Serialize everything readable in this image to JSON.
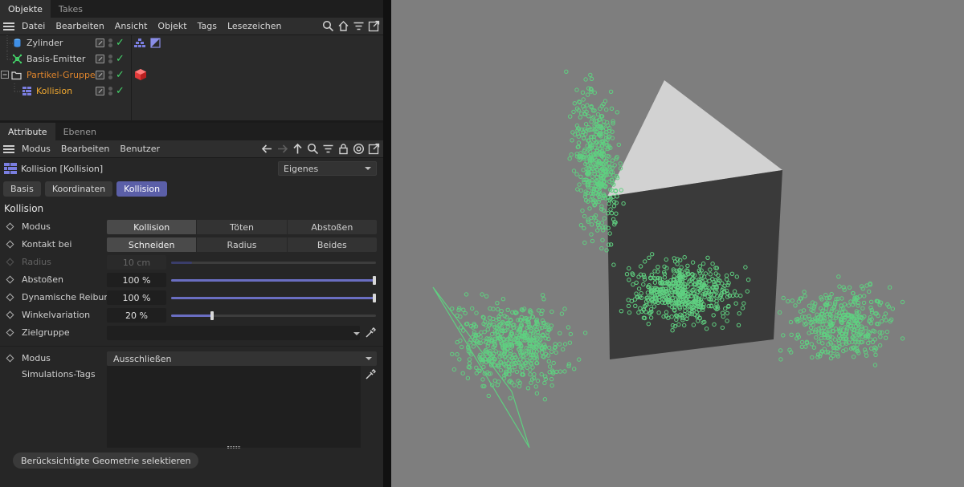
{
  "object_manager": {
    "tabs": [
      {
        "label": "Objekte",
        "active": true
      },
      {
        "label": "Takes",
        "active": false
      }
    ],
    "menu": [
      "Datei",
      "Bearbeiten",
      "Ansicht",
      "Objekt",
      "Tags",
      "Lesezeichen"
    ],
    "toolbar_icons": [
      "search-icon",
      "home-icon",
      "filter-icon",
      "popout-icon"
    ],
    "objects": [
      {
        "name": "Zylinder",
        "icon": "cylinder-icon",
        "indent": 1,
        "color": "#d8d8d8",
        "tags": [
          "cloth-tag-icon",
          "phong-tag-icon"
        ]
      },
      {
        "name": "Basis-Emitter",
        "icon": "emitter-icon",
        "indent": 1,
        "color": "#d8d8d8",
        "tags": []
      },
      {
        "name": "Partikel-Gruppe",
        "icon": "folder-icon",
        "indent": 0,
        "color": "#e0852c",
        "tags": [
          "particle-group-tag-icon"
        ]
      },
      {
        "name": "Kollision",
        "icon": "collision-icon",
        "indent": 2,
        "color": "#f0a830",
        "tags": []
      }
    ]
  },
  "attribute_manager": {
    "tabs": [
      {
        "label": "Attribute",
        "active": true
      },
      {
        "label": "Ebenen",
        "active": false
      }
    ],
    "menu": [
      "Modus",
      "Bearbeiten",
      "Benutzer"
    ],
    "toolbar_icons": [
      "arrow-left-icon",
      "arrow-right-icon",
      "arrow-up-icon",
      "search-icon",
      "filter-icon",
      "lock-icon",
      "target-icon",
      "popout-icon"
    ],
    "object_title": "Kollision [Kollision]",
    "preset": "Eigenes",
    "pills": [
      {
        "label": "Basis",
        "active": false
      },
      {
        "label": "Koordinaten",
        "active": false
      },
      {
        "label": "Kollision",
        "active": true
      }
    ],
    "section_title": "Kollision",
    "modus": {
      "label": "Modus",
      "options": [
        "Kollision",
        "Töten",
        "Abstoßen"
      ],
      "selected": 0
    },
    "kontakt": {
      "label": "Kontakt bei",
      "options": [
        "Schneiden",
        "Radius",
        "Beides"
      ],
      "selected": 0
    },
    "radius": {
      "label": "Radius",
      "value": "10 cm",
      "fraction": 0.1
    },
    "abstossen": {
      "label": "Abstoßen",
      "value": "100 %",
      "fraction": 1.0
    },
    "reibung": {
      "label": "Dynamische Reibung",
      "value": "100 %",
      "fraction": 1.0
    },
    "winkel": {
      "label": "Winkelvariation",
      "value": "20 %",
      "fraction": 0.2
    },
    "zielgruppe": {
      "label": "Zielgruppe",
      "value": ""
    },
    "modus2": {
      "label": "Modus",
      "value": "Ausschließen"
    },
    "simtags": {
      "label": "Simulations-Tags"
    },
    "button": "Berücksichtigte Geometrie selektieren"
  },
  "viewport": {
    "background": "#7e7e7e",
    "particle_color": "#5fd080"
  }
}
